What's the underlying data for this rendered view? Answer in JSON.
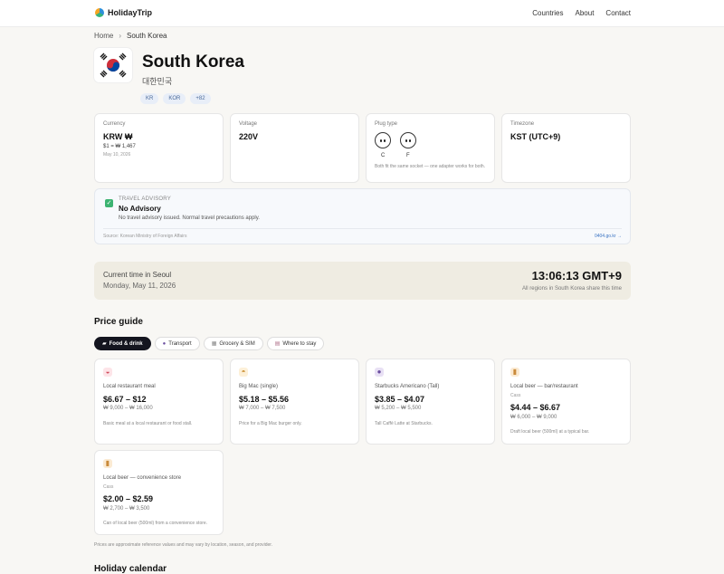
{
  "header": {
    "brand": "HolidayTrip",
    "nav": [
      "Countries",
      "About",
      "Contact"
    ]
  },
  "breadcrumb": {
    "home": "Home",
    "separator": "›",
    "current": "South Korea"
  },
  "country": {
    "name": "South Korea",
    "native_name": "대한민국",
    "codes": [
      "KR",
      "KOR",
      "+82"
    ]
  },
  "info": {
    "currency": {
      "label": "Currency",
      "value": "KRW ₩",
      "rate": "$1 = ₩ 1,467",
      "date": "May 10, 2026"
    },
    "voltage": {
      "label": "Voltage",
      "value": "220V"
    },
    "plug": {
      "label": "Plug type",
      "types": [
        "C",
        "F"
      ],
      "note": "Both fit the same socket — one adapter works for both."
    },
    "timezone": {
      "label": "Timezone",
      "value": "KST (UTC+9)"
    }
  },
  "advisory": {
    "kicker": "TRAVEL ADVISORY",
    "title": "No Advisory",
    "description": "No travel advisory issued. Normal travel precautions apply.",
    "source": "Source: Korean Ministry of Foreign Affairs",
    "link": "0404.go.kr →",
    "status_color": "#3cb371"
  },
  "time": {
    "label": "Current time in Seoul",
    "date": "Monday, May 11, 2026",
    "value": "13:06:13 GMT+9",
    "note": "All regions in South Korea share this time"
  },
  "price_guide": {
    "title": "Price guide",
    "tabs": [
      {
        "label": "Food & drink",
        "icon": "food-icon",
        "active": true
      },
      {
        "label": "Transport",
        "icon": "transport-icon",
        "active": false
      },
      {
        "label": "Grocery & SIM",
        "icon": "grocery-icon",
        "active": false
      },
      {
        "label": "Where to stay",
        "icon": "hotel-icon",
        "active": false
      }
    ],
    "items": [
      {
        "icon": "bowl-icon",
        "name": "Local restaurant meal",
        "brand": "",
        "price": "$6.67 – $12",
        "local": "₩ 9,000 – ₩ 16,000",
        "desc": "Basic meal at a local restaurant or food stall."
      },
      {
        "icon": "burger-icon",
        "name": "Big Mac (single)",
        "brand": "",
        "price": "$5.18 – $5.56",
        "local": "₩ 7,000 – ₩ 7,500",
        "desc": "Price for a Big Mac burger only."
      },
      {
        "icon": "coffee-icon",
        "name": "Starbucks Americano (Tall)",
        "brand": "",
        "price": "$3.85 – $4.07",
        "local": "₩ 5,200 – ₩ 5,500",
        "desc": "Tall Caffè Latte at Starbucks."
      },
      {
        "icon": "beer-icon",
        "name": "Local beer — bar/restaurant",
        "brand": "Cass",
        "price": "$4.44 – $6.67",
        "local": "₩ 6,000 – ₩ 9,000",
        "desc": "Draft local beer (500ml) at a typical bar."
      },
      {
        "icon": "beer-icon",
        "name": "Local beer — convenience store",
        "brand": "Cass",
        "price": "$2.00 – $2.59",
        "local": "₩ 2,700 – ₩ 3,500",
        "desc": "Can of local beer (500ml) from a convenience store."
      }
    ],
    "footnote": "Prices are approximate reference values and may vary by location, season, and provider."
  },
  "next_section": {
    "title": "Holiday calendar"
  }
}
